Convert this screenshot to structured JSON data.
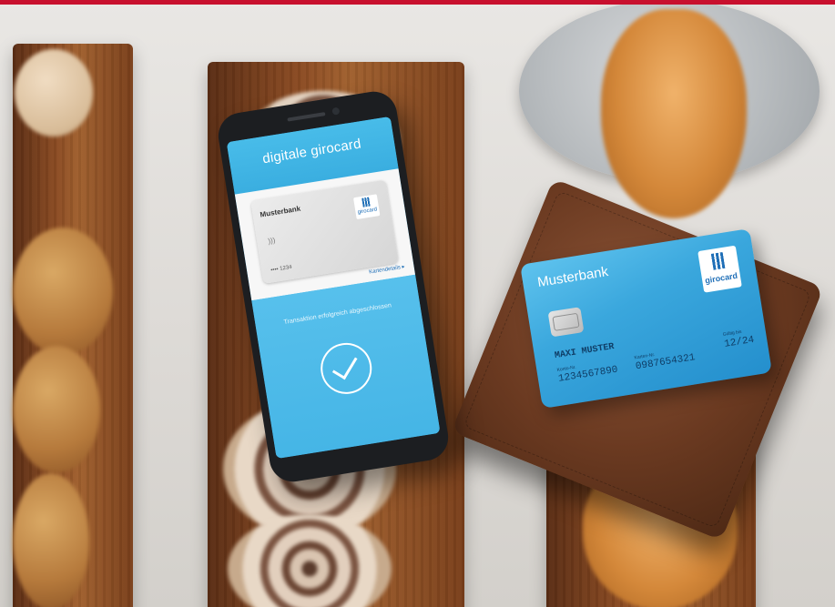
{
  "phone": {
    "title": "digitale girocard",
    "card_bank": "Musterbank",
    "card_logo_text": "girocard",
    "card_number": "•••• 1234",
    "card_details_link": "Kartendetails ▸",
    "status_text": "Transaktion erfolgreich abgeschlossen"
  },
  "card": {
    "bank": "Musterbank",
    "logo_text": "girocard",
    "holder": "MAXI MUSTER",
    "account_label": "Konto-Nr.",
    "account_number": "1234567890",
    "card_label": "Karten-Nr.",
    "card_number": "0987654321",
    "valid_label": "Gültig bis",
    "valid_until": "12/24"
  },
  "colors": {
    "accent_red": "#c8102e",
    "app_blue": "#3fb3e6",
    "card_blue": "#3aa7dd"
  },
  "icons": [
    "contactless-icon",
    "checkmark-circle-icon",
    "girocard-logo-icon"
  ]
}
